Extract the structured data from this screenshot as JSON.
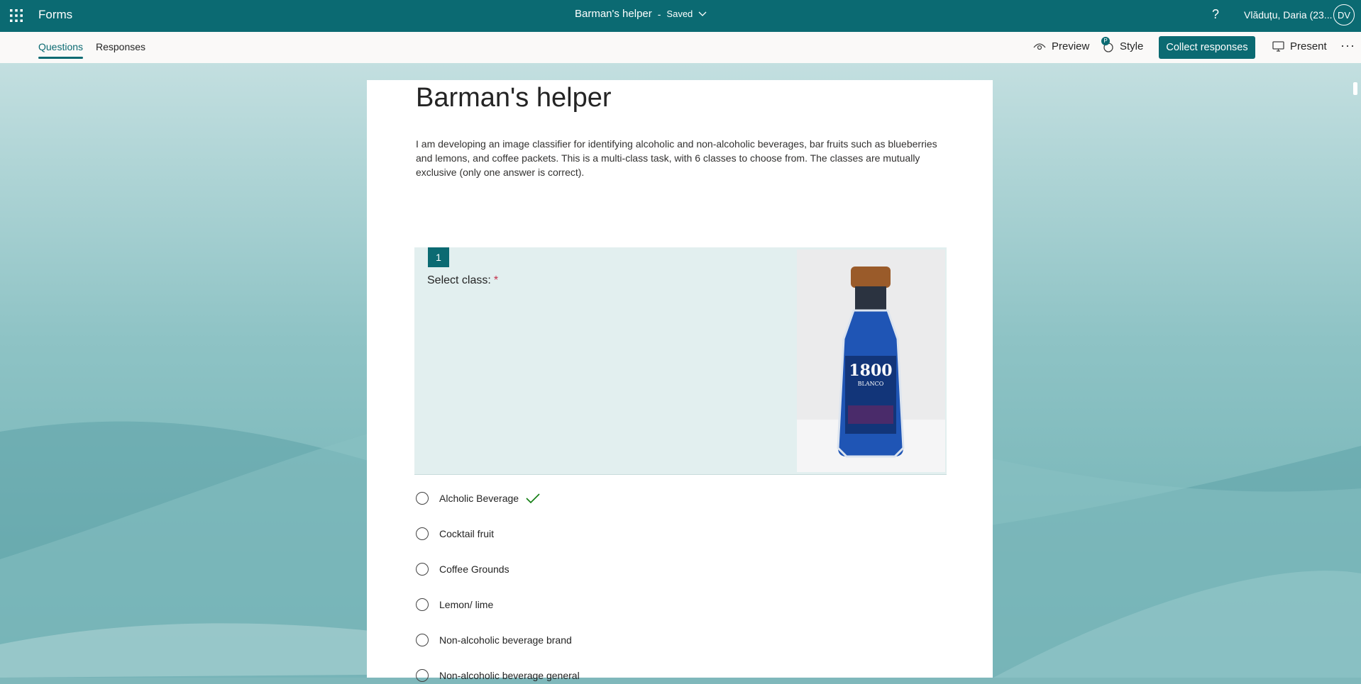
{
  "topbar": {
    "app_name": "Forms",
    "doc_title": "Barman's helper",
    "separator": "-",
    "save_status": "Saved",
    "user_name": "Vlăduțu, Daria (23...",
    "user_initials": "DV",
    "help_icon": "question-icon"
  },
  "cmdbar": {
    "tabs": [
      {
        "label": "Questions",
        "active": true
      },
      {
        "label": "Responses",
        "active": false
      }
    ],
    "preview_label": "Preview",
    "style_label": "Style",
    "style_badge": "P",
    "collect_label": "Collect responses",
    "present_label": "Present",
    "more_label": "···"
  },
  "form": {
    "title": "Barman's helper",
    "description": "I am developing an image classifier for identifying alcoholic and non-alcoholic beverages, bar fruits such as blueberries and lemons, and coffee packets. This is a multi-class task, with 6 classes to choose from. The classes are mutually exclusive (only one answer is correct).",
    "question": {
      "number": "1",
      "text": "Select class:",
      "required_mark": "*",
      "image_label_top": "1800",
      "image_label_sub": "BLANCO",
      "options": [
        {
          "label": "Alcholic Beverage",
          "marked_correct": true
        },
        {
          "label": "Cocktail fruit",
          "marked_correct": false
        },
        {
          "label": "Coffee Grounds",
          "marked_correct": false
        },
        {
          "label": "Lemon/ lime",
          "marked_correct": false
        },
        {
          "label": "Non-alcoholic beverage brand",
          "marked_correct": false
        },
        {
          "label": "Non-alcoholic beverage general",
          "marked_correct": false
        }
      ]
    }
  },
  "colors": {
    "brand": "#0b6a72",
    "required": "#c4314b",
    "check": "#107c10"
  }
}
